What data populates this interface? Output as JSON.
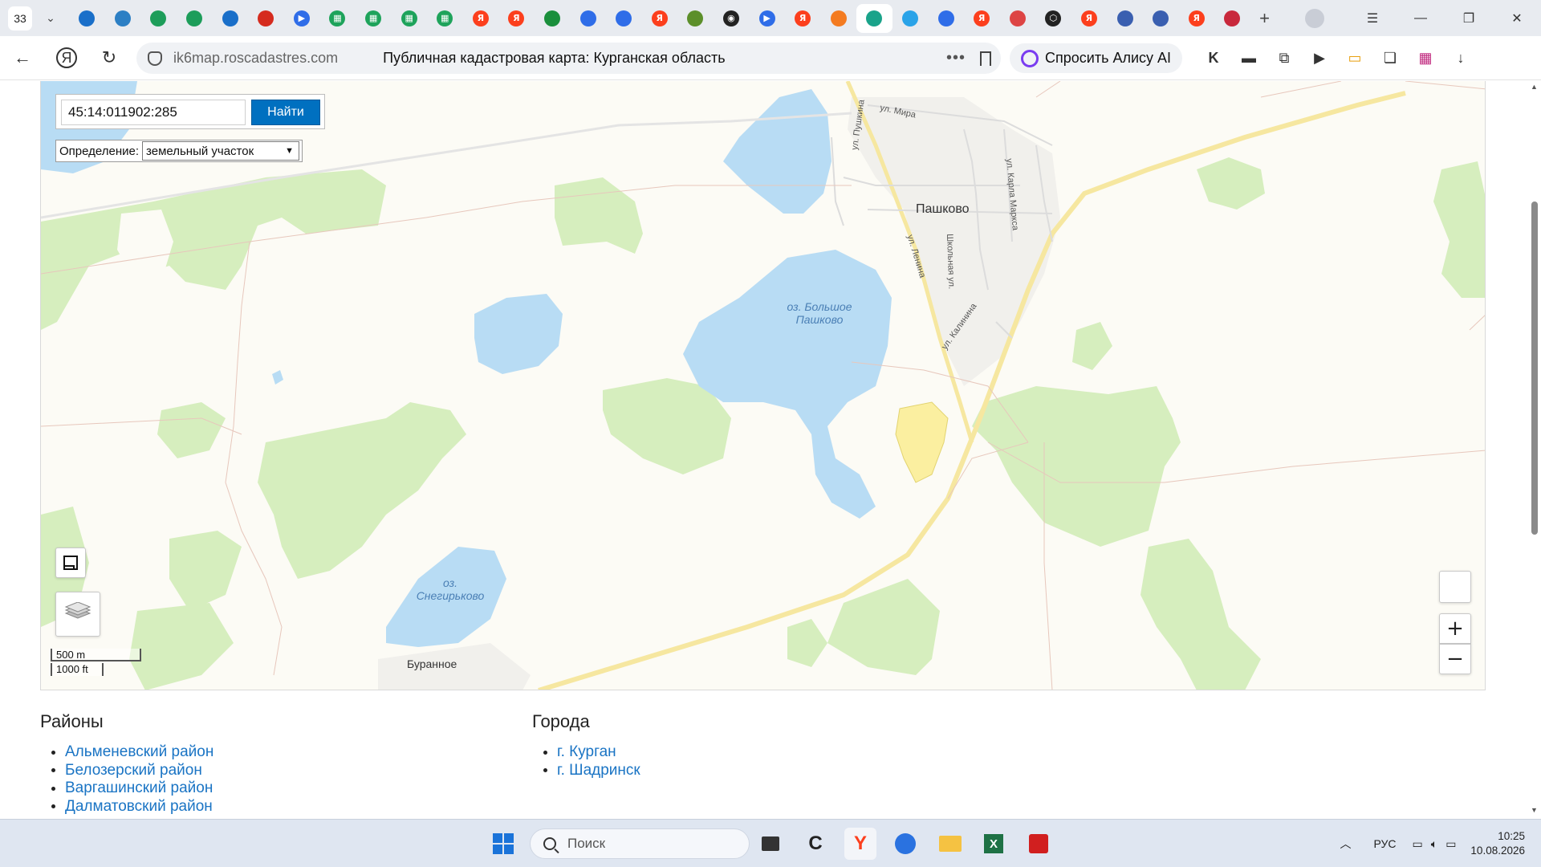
{
  "browser": {
    "tab_count": "33",
    "tabs": [
      {
        "icon": "gosuslugi-eagle-icon",
        "color": "#1a6fc9"
      },
      {
        "icon": "rosreestr-icon",
        "color": "#2c7fc4"
      },
      {
        "icon": "shield-icon",
        "color": "#1d9d5a"
      },
      {
        "icon": "shield-icon",
        "color": "#1d9d5a"
      },
      {
        "icon": "gosuslugi-eagle-icon",
        "color": "#1a6fc9"
      },
      {
        "icon": "russia-flag-icon",
        "color": "#d52b1e"
      },
      {
        "icon": "video-icon",
        "color": "#2f6de8"
      },
      {
        "icon": "spreadsheet-icon",
        "color": "#1ea35b"
      },
      {
        "icon": "spreadsheet-icon",
        "color": "#1ea35b"
      },
      {
        "icon": "spreadsheet-icon",
        "color": "#1ea35b"
      },
      {
        "icon": "spreadsheet-icon",
        "color": "#1ea35b"
      },
      {
        "icon": "yandex-icon",
        "color": "#fc3f1d"
      },
      {
        "icon": "yandex-icon",
        "color": "#fc3f1d"
      },
      {
        "icon": "flag-icon",
        "color": "#1a8f3c"
      },
      {
        "icon": "globe-icon",
        "color": "#2f6de8"
      },
      {
        "icon": "globe-icon",
        "color": "#2f6de8"
      },
      {
        "icon": "yandex-icon",
        "color": "#fc3f1d"
      },
      {
        "icon": "robot-icon",
        "color": "#5c8f2a"
      },
      {
        "icon": "eye-icon",
        "color": "#222222"
      },
      {
        "icon": "video-icon",
        "color": "#2f6de8"
      },
      {
        "icon": "yandex-icon",
        "color": "#fc3f1d"
      },
      {
        "icon": "bookmark-icon",
        "color": "#f47b20"
      },
      {
        "icon": "sparkle-icon",
        "color": "#1aa38a",
        "active": true
      },
      {
        "icon": "swirl-icon",
        "color": "#2aa3e8"
      },
      {
        "icon": "arrows-icon",
        "color": "#2f6de8"
      },
      {
        "icon": "yandex-icon",
        "color": "#fc3f1d"
      },
      {
        "icon": "document-icon",
        "color": "#d44"
      },
      {
        "icon": "openai-icon",
        "color": "#222222"
      },
      {
        "icon": "yandex-icon",
        "color": "#fc3f1d"
      },
      {
        "icon": "gosuslugi-eagle-icon",
        "color": "#3a5fb0"
      },
      {
        "icon": "gosuslugi-eagle-icon",
        "color": "#3a5fb0"
      },
      {
        "icon": "yandex-icon",
        "color": "#fc3f1d"
      },
      {
        "icon": "heart-flag-icon",
        "color": "#c8283c"
      }
    ],
    "url": "ik6map.roscadastres.com",
    "page_title": "Публичная кадастровая карта: Курганская область",
    "alice_label": "Спросить Алису AI"
  },
  "map": {
    "search_value": "45:14:011902:285",
    "search_button": "Найти",
    "definition_label": "Определение:",
    "definition_value": "земельный участок",
    "zoom_in": "+",
    "zoom_out": "−",
    "scale_metric": "500 m",
    "scale_imperial": "1000 ft",
    "labels": {
      "town_pashkovo": "Пашково",
      "town_buranoe": "Буранное",
      "lake_bolshoe_1": "оз. Большое",
      "lake_bolshoe_2": "Пашково",
      "lake_snegir_1": "оз.",
      "lake_snegir_2": "Снегирьково",
      "street_mira": "ул. Мира",
      "street_pushkina": "ул. Пушкина",
      "street_lenina": "ул. Ленина",
      "street_shkolnaya": "Школьная ул.",
      "street_marksa": "ул. Карла Маркса",
      "street_kalinina": "ул. Калинина"
    },
    "colors": {
      "forest": "#d6eebe",
      "water": "#b8dcf4",
      "road": "#f6e7a0",
      "highlight": "#fbefa0"
    }
  },
  "districts": {
    "title": "Районы",
    "items": [
      "Альменевский район",
      "Белозерский район",
      "Варгашинский район",
      "Далматовский район"
    ]
  },
  "cities": {
    "title": "Города",
    "items": [
      "г. Курган",
      "г. Шадринск"
    ]
  },
  "taskbar": {
    "search_placeholder": "Поиск",
    "language": "РУС",
    "time": "10:25",
    "date": "10.08.2026"
  }
}
